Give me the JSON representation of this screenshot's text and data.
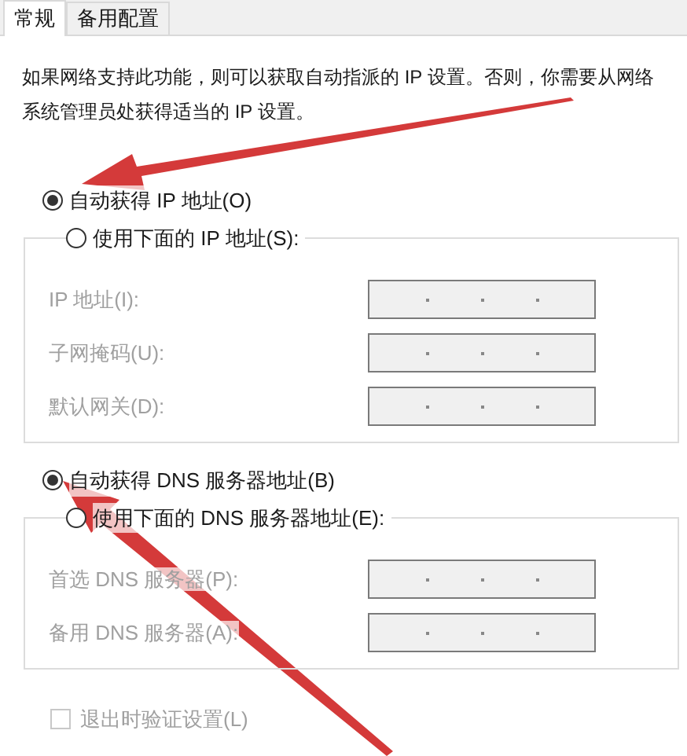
{
  "tabs": [
    {
      "label": "常规",
      "selected": true
    },
    {
      "label": "备用配置",
      "selected": false
    }
  ],
  "description": "如果网络支持此功能，则可以获取自动指派的 IP 设置。否则，你需要从网络系统管理员处获得适当的 IP 设置。",
  "ip_mode": [
    {
      "label": "自动获得 IP 地址(O)",
      "selected": true
    },
    {
      "label": "使用下面的 IP 地址(S):",
      "selected": false
    }
  ],
  "ip_fields": [
    {
      "label": "IP 地址(I):",
      "disabled": true
    },
    {
      "label": "子网掩码(U):",
      "disabled": true
    },
    {
      "label": "默认网关(D):",
      "disabled": true
    }
  ],
  "dns_mode": [
    {
      "label": "自动获得 DNS 服务器地址(B)",
      "selected": true
    },
    {
      "label": "使用下面的 DNS 服务器地址(E):",
      "selected": false
    }
  ],
  "dns_fields": [
    {
      "label": "首选 DNS 服务器(P):",
      "disabled": true
    },
    {
      "label": "备用 DNS 服务器(A):",
      "disabled": true
    }
  ],
  "validate_on_exit": {
    "label": "退出时验证设置(L)",
    "checked": false,
    "disabled": true
  }
}
